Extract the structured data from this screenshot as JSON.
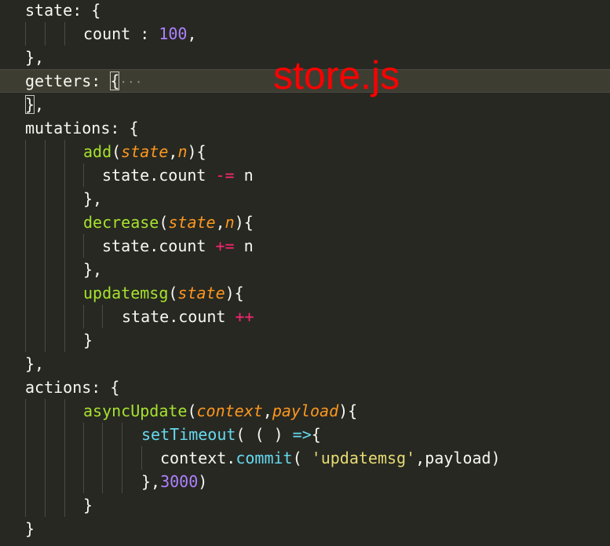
{
  "overlay": {
    "title": "store.js"
  },
  "code": {
    "lines": [
      {
        "tokens": [
          {
            "c": "t-plain",
            "t": "state: {"
          }
        ]
      },
      {
        "tokens": [
          {
            "c": "t-plain",
            "t": "count : "
          },
          {
            "c": "t-num",
            "t": "100"
          },
          {
            "c": "t-plain",
            "t": ","
          }
        ]
      },
      {
        "tokens": [
          {
            "c": "t-plain",
            "t": "},"
          }
        ]
      },
      {
        "tokens": [
          {
            "c": "t-plain",
            "t": "getters: "
          },
          {
            "c": "t-plain",
            "t": "{"
          },
          {
            "c": "t-fold",
            "t": "···"
          }
        ]
      },
      {
        "tokens": [
          {
            "c": "t-plain",
            "t": "}"
          },
          {
            "c": "t-plain",
            "t": ","
          }
        ]
      },
      {
        "tokens": [
          {
            "c": "t-plain",
            "t": "mutations: {"
          }
        ]
      },
      {
        "tokens": [
          {
            "c": "t-func",
            "t": "add"
          },
          {
            "c": "t-plain",
            "t": "("
          },
          {
            "c": "t-param",
            "t": "state"
          },
          {
            "c": "t-plain",
            "t": ","
          },
          {
            "c": "t-param",
            "t": "n"
          },
          {
            "c": "t-plain",
            "t": "){"
          }
        ]
      },
      {
        "tokens": [
          {
            "c": "t-plain",
            "t": "state.count "
          },
          {
            "c": "t-op",
            "t": "-="
          },
          {
            "c": "t-plain",
            "t": " n"
          }
        ]
      },
      {
        "tokens": [
          {
            "c": "t-plain",
            "t": "},"
          }
        ]
      },
      {
        "tokens": [
          {
            "c": "t-func",
            "t": "decrease"
          },
          {
            "c": "t-plain",
            "t": "("
          },
          {
            "c": "t-param",
            "t": "state"
          },
          {
            "c": "t-plain",
            "t": ","
          },
          {
            "c": "t-param",
            "t": "n"
          },
          {
            "c": "t-plain",
            "t": "){"
          }
        ]
      },
      {
        "tokens": [
          {
            "c": "t-plain",
            "t": "state.count "
          },
          {
            "c": "t-op",
            "t": "+="
          },
          {
            "c": "t-plain",
            "t": " n"
          }
        ]
      },
      {
        "tokens": [
          {
            "c": "t-plain",
            "t": "},"
          }
        ]
      },
      {
        "tokens": [
          {
            "c": "t-func",
            "t": "updatemsg"
          },
          {
            "c": "t-plain",
            "t": "("
          },
          {
            "c": "t-param",
            "t": "state"
          },
          {
            "c": "t-plain",
            "t": "){"
          }
        ]
      },
      {
        "tokens": [
          {
            "c": "t-plain",
            "t": "state.count "
          },
          {
            "c": "t-op",
            "t": "++"
          }
        ]
      },
      {
        "tokens": [
          {
            "c": "t-plain",
            "t": "}"
          }
        ]
      },
      {
        "tokens": [
          {
            "c": "t-plain",
            "t": "},"
          }
        ]
      },
      {
        "tokens": [
          {
            "c": "t-plain",
            "t": "actions: {"
          }
        ]
      },
      {
        "tokens": [
          {
            "c": "t-func",
            "t": "asyncUpdate"
          },
          {
            "c": "t-plain",
            "t": "("
          },
          {
            "c": "t-param",
            "t": "context"
          },
          {
            "c": "t-plain",
            "t": ","
          },
          {
            "c": "t-param",
            "t": "payload"
          },
          {
            "c": "t-plain",
            "t": "){"
          }
        ]
      },
      {
        "tokens": [
          {
            "c": "t-call",
            "t": "setTimeout"
          },
          {
            "c": "t-plain",
            "t": "( ( ) "
          },
          {
            "c": "t-call",
            "t": "=>"
          },
          {
            "c": "t-plain",
            "t": "{"
          }
        ]
      },
      {
        "tokens": [
          {
            "c": "t-plain",
            "t": "context."
          },
          {
            "c": "t-call",
            "t": "commit"
          },
          {
            "c": "t-plain",
            "t": "( "
          },
          {
            "c": "t-str",
            "t": "'updatemsg'"
          },
          {
            "c": "t-plain",
            "t": ",payload)"
          }
        ]
      },
      {
        "tokens": [
          {
            "c": "t-plain",
            "t": "},"
          },
          {
            "c": "t-num",
            "t": "3000"
          },
          {
            "c": "t-plain",
            "t": ")"
          }
        ]
      },
      {
        "tokens": [
          {
            "c": "t-plain",
            "t": "}"
          }
        ]
      },
      {
        "tokens": [
          {
            "c": "t-plain",
            "t": "}"
          }
        ]
      }
    ]
  }
}
